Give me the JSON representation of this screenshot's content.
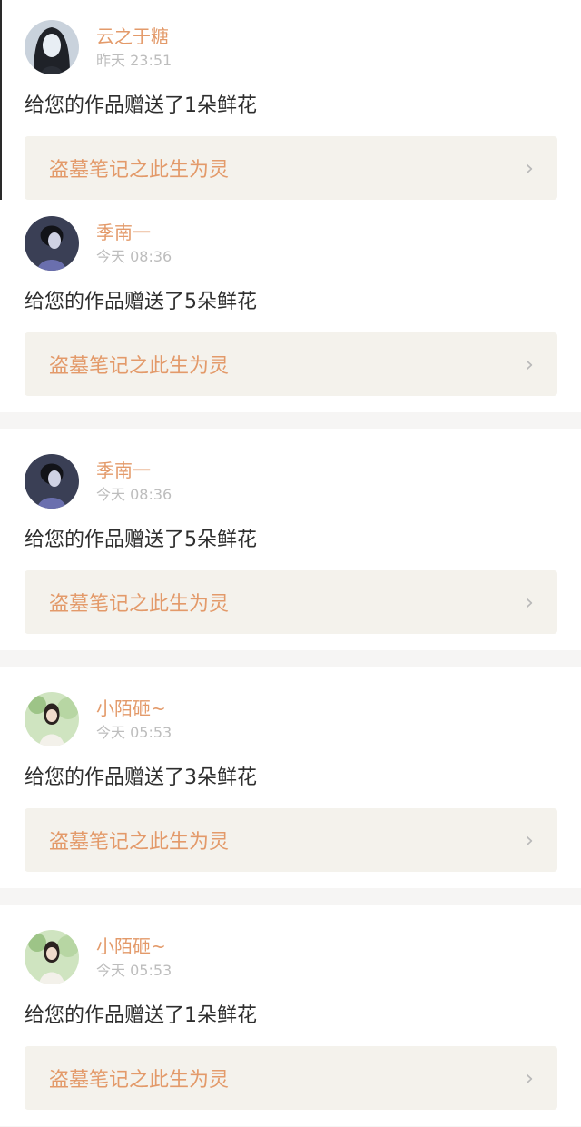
{
  "items": [
    {
      "name": "云之于糖",
      "time": "昨天 23:51",
      "message": "给您的作品赠送了1朵鲜花",
      "work_title": "盗墓笔记之此生为灵",
      "avatar": "anime-girl-dark-hair-avatar"
    },
    {
      "name": "季南一",
      "time": "今天 08:36",
      "message": "给您的作品赠送了5朵鲜花",
      "work_title": "盗墓笔记之此生为灵",
      "avatar": "anime-boy-dark-avatar"
    },
    {
      "name": "季南一",
      "time": "今天 08:36",
      "message": "给您的作品赠送了5朵鲜花",
      "work_title": "盗墓笔记之此生为灵",
      "avatar": "anime-boy-dark-avatar"
    },
    {
      "name": "小陌砸~",
      "time": "今天 05:53",
      "message": "给您的作品赠送了3朵鲜花",
      "work_title": "盗墓笔记之此生为灵",
      "avatar": "girl-green-field-avatar"
    },
    {
      "name": "小陌砸~",
      "time": "今天 05:53",
      "message": "给您的作品赠送了1朵鲜花",
      "work_title": "盗墓笔记之此生为灵",
      "avatar": "girl-green-field-avatar"
    }
  ],
  "colors": {
    "accent": "#e39a6a",
    "meta_gray": "#bdbdbd",
    "work_bg": "#f4f2ec"
  },
  "icons": {
    "chevron": "chevron-right-icon"
  }
}
